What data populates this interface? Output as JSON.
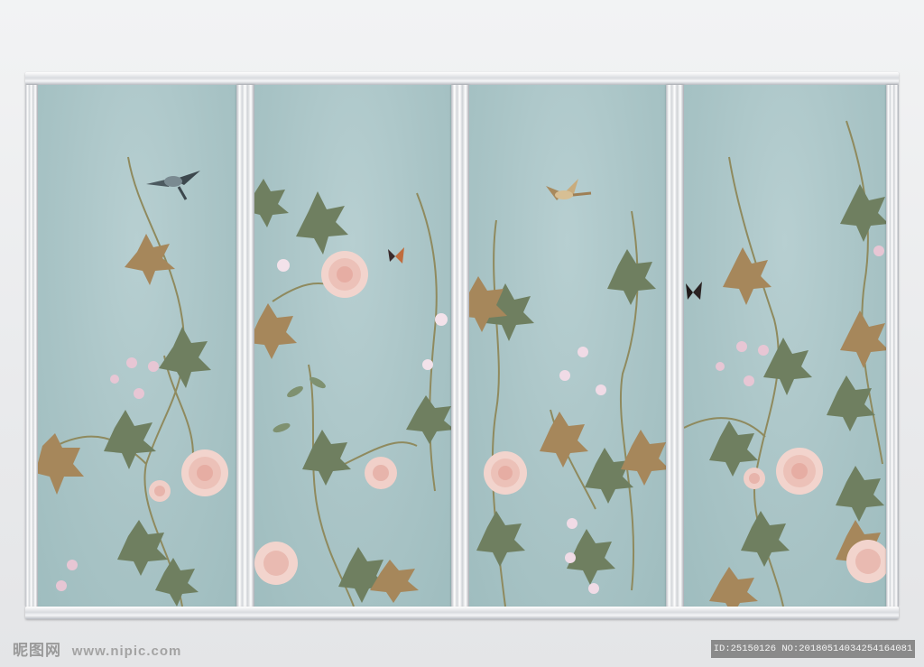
{
  "watermark": {
    "brand": "昵图网",
    "url": "www.nipic.com"
  },
  "id_label": "ID:25150126 NO:20180514034254164081",
  "colors": {
    "panel": "#a9c4c6",
    "leaf_green": "#6f7f60",
    "leaf_brown": "#9c7a4c",
    "peony": "#f1cfc8",
    "frame": "#e6e8ea"
  }
}
